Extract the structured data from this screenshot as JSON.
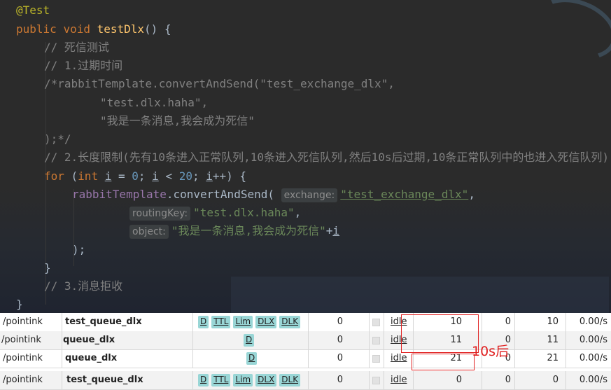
{
  "code": {
    "annotation": "@Test",
    "kw_public": "public",
    "kw_void": "void",
    "method_name": "testDlx",
    "method_tail": "() {",
    "comment_title": "// 死信测试",
    "comment_1": "// 1.过期时间",
    "block_open": "/*",
    "block_line1": "rabbitTemplate.convertAndSend(\"test_exchange_dlx\",",
    "block_line2": "\"test.dlx.haha\",",
    "block_line3": "\"我是一条消息,我会成为死信\"",
    "block_close": ");*/",
    "comment_2": "// 2.长度限制(先有10条进入正常队列,10条进入死信队列,然后10s后过期,10条正常队列中的也进入死信队列)",
    "for_kw": "for",
    "for_open": " (",
    "for_int": "int",
    "for_var": "i",
    "for_eq": " = ",
    "for_zero": "0",
    "for_semi1": "; ",
    "for_lt": " < ",
    "for_twenty": "20",
    "for_semi2": "; ",
    "for_inc": "++) {",
    "call_obj": "rabbitTemplate",
    "call_method": ".convertAndSend(",
    "hint_exchange": "exchange:",
    "arg_exchange": "\"test_exchange_dlx\"",
    "comma": ",",
    "hint_routing": "routingKey:",
    "arg_routing": "\"test.dlx.haha\"",
    "hint_object": "object:",
    "arg_object": "\"我是一条消息,我会成为死信\"",
    "plus": "+",
    "call_close": ");",
    "brace_close_inner": "}",
    "comment_3": "// 3.消息拒收",
    "brace_close_outer": "}"
  },
  "queues": {
    "rows": [
      {
        "vhost": "/pointink",
        "name": "test_queue_dlx",
        "tags": [
          "D",
          "TTL",
          "Lim",
          "DLX",
          "DLK"
        ],
        "col_a": "0",
        "state": "idle",
        "ready": "10",
        "unacked": "0",
        "total": "10",
        "rate": "0.00/s"
      },
      {
        "vhost": "/pointink",
        "name": "queue_dlx",
        "tags": [
          "D"
        ],
        "col_a": "0",
        "state": "idle",
        "ready": "11",
        "unacked": "0",
        "total": "11",
        "rate": "0.00/s"
      },
      {
        "vhost": "/pointink",
        "name": "queue_dlx",
        "tags": [
          "D"
        ],
        "col_a": "0",
        "state": "idle",
        "ready": "21",
        "unacked": "0",
        "total": "21",
        "rate": "0.00/s"
      },
      {
        "vhost": "/pointink",
        "name": "test_queue_dlx",
        "tags": [
          "D",
          "TTL",
          "Lim",
          "DLX",
          "DLK"
        ],
        "col_a": "0",
        "state": "idle",
        "ready": "0",
        "unacked": "0",
        "total": "0",
        "rate": "0.00/s"
      }
    ]
  },
  "annotation_label": "10s后",
  "colors": {
    "annotation_red": "#e02020",
    "tag_bg": "#99d6d6",
    "editor_bg": "#2b2b2b"
  }
}
